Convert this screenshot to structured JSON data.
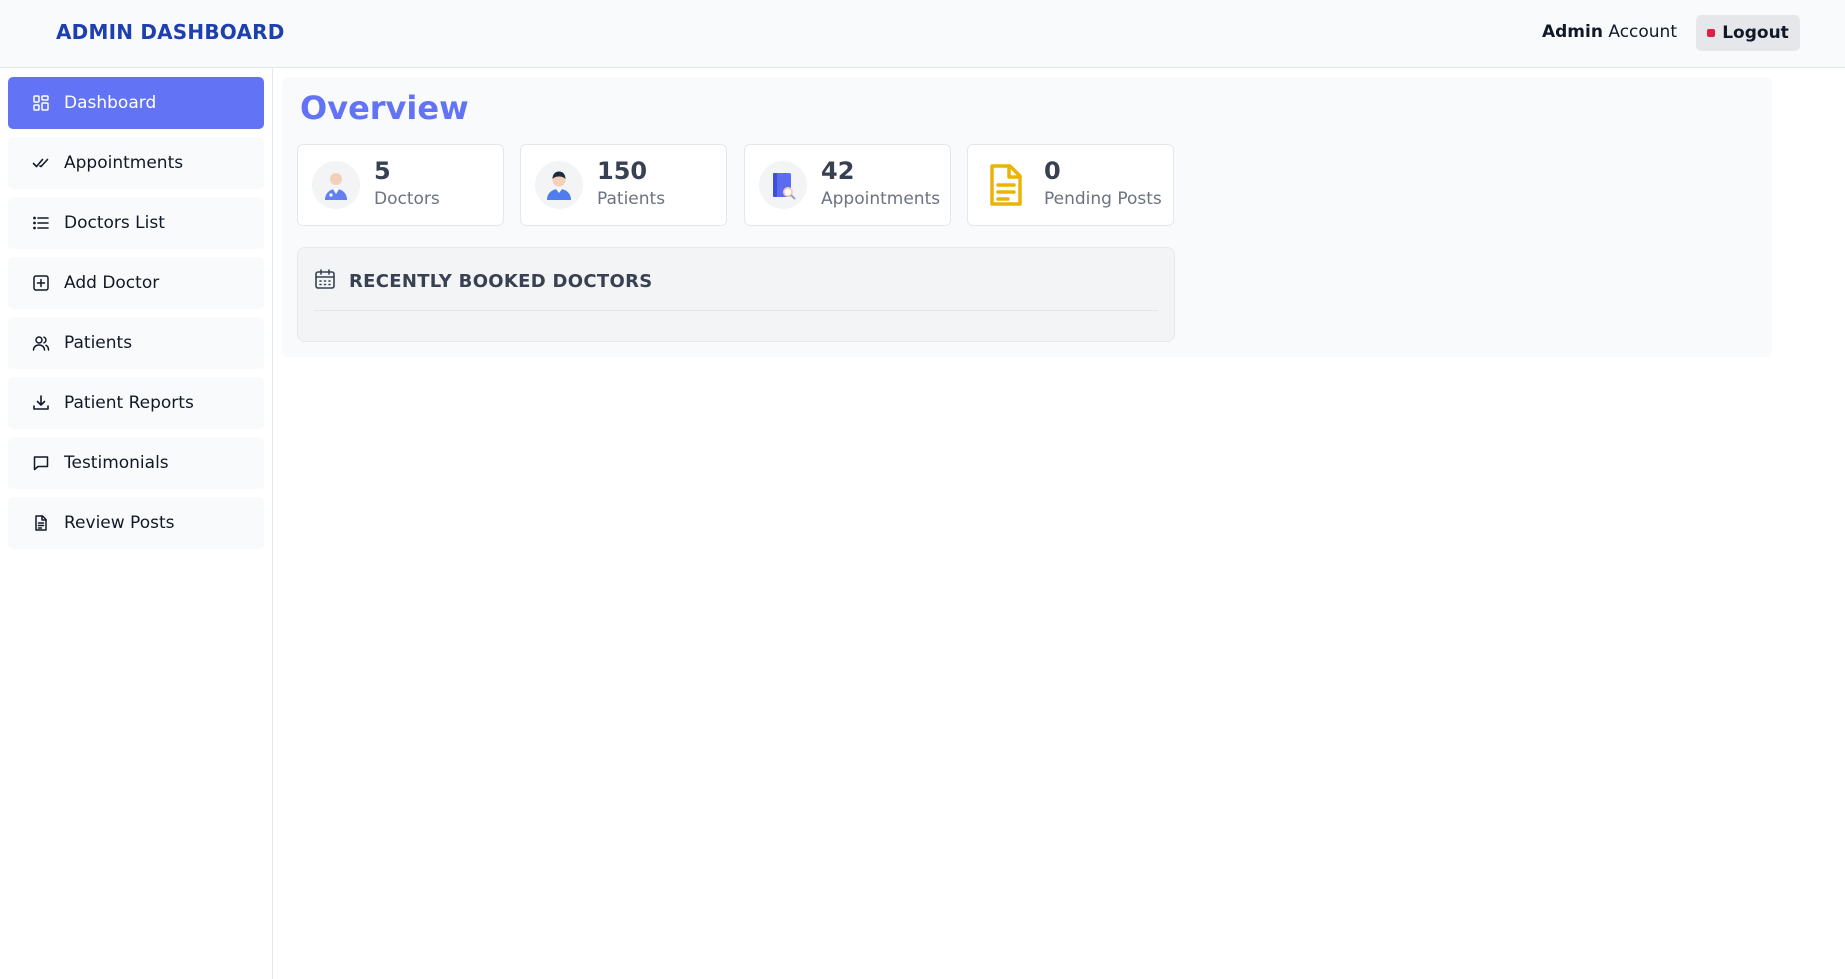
{
  "header": {
    "brand": "ADMIN DASHBOARD",
    "account_bold": "Admin",
    "account_rest": " Account",
    "logout_label": "Logout"
  },
  "sidebar": {
    "items": [
      {
        "label": "Dashboard",
        "icon": "dashboard-grid-icon",
        "active": true
      },
      {
        "label": "Appointments",
        "icon": "double-check-icon"
      },
      {
        "label": "Doctors List",
        "icon": "list-icon"
      },
      {
        "label": "Add Doctor",
        "icon": "plus-square-icon"
      },
      {
        "label": "Patients",
        "icon": "users-icon"
      },
      {
        "label": "Patient Reports",
        "icon": "download-icon"
      },
      {
        "label": "Testimonials",
        "icon": "message-icon"
      },
      {
        "label": "Review Posts",
        "icon": "document-icon"
      }
    ]
  },
  "main": {
    "title": "Overview",
    "stats": [
      {
        "value": "5",
        "label": "Doctors",
        "icon": "doctor-avatar-icon"
      },
      {
        "value": "150",
        "label": "Patients",
        "icon": "patient-avatar-icon"
      },
      {
        "value": "42",
        "label": "Appointments",
        "icon": "appointment-book-icon"
      },
      {
        "value": "0",
        "label": "Pending Posts",
        "icon": "pending-document-icon"
      }
    ],
    "recent": {
      "title": "RECENTLY BOOKED DOCTORS",
      "icon": "calendar-icon"
    }
  },
  "colors": {
    "accent": "#6373f5",
    "brand": "#1e40af",
    "logout_dot": "#e11d48",
    "pending_icon": "#eab308"
  }
}
